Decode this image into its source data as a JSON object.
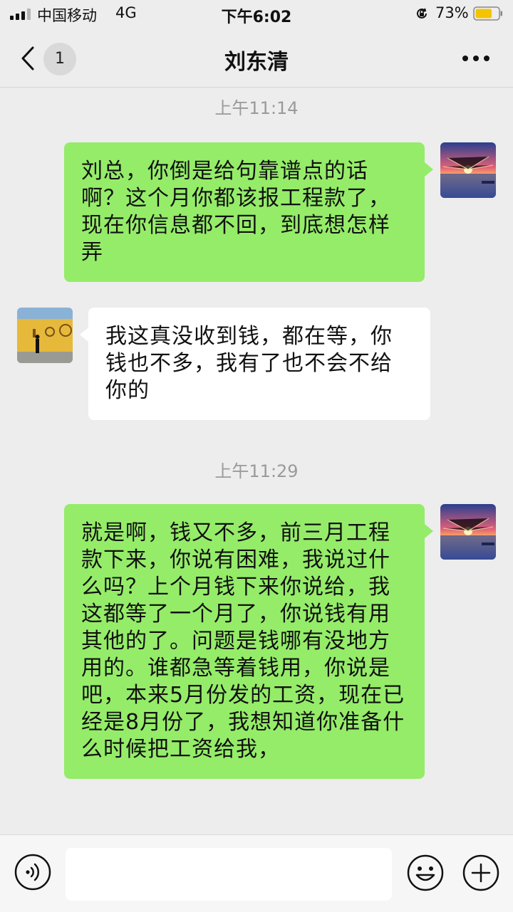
{
  "status_bar": {
    "carrier": "中国移动",
    "network": "4G",
    "time": "下午6:02",
    "battery_percent": "73%",
    "battery_level": 0.73,
    "battery_color": "#f5c400",
    "icons": [
      "signal-icon",
      "orientation-lock-icon",
      "battery-icon"
    ]
  },
  "nav": {
    "unread_count": "1",
    "title": "刘东清",
    "icons": [
      "back-chevron-icon",
      "more-icon"
    ]
  },
  "chat": {
    "messages": [
      {
        "type": "time",
        "text": "上午11:14"
      },
      {
        "type": "sent",
        "text": "刘总，你倒是给句靠谱点的话啊？这个月你都该报工程款了，现在你信息都不回，到底想怎样弄"
      },
      {
        "type": "received",
        "text": "我这真没收到钱，都在等，你钱也不多，我有了也不会不给你的"
      },
      {
        "type": "time",
        "text": "上午11:29"
      },
      {
        "type": "sent",
        "text": "就是啊，钱又不多，前三月工程款下来，你说有困难，我说过什么吗？上个月钱下来你说给，我这都等了一个月了，你说钱有用其他的了。问题是钱哪有没地方用的。谁都急等着钱用，你说是吧，本来5月份发的工资，现在已经是8月份了，我想知道你准备什么时候把工资给我，"
      }
    ]
  },
  "input_bar": {
    "text_value": "",
    "icons": [
      "voice-icon",
      "emoji-icon",
      "plus-icon"
    ]
  },
  "colors": {
    "background": "#ededed",
    "sent_bubble": "#95ec69",
    "received_bubble": "#ffffff",
    "timestamp_text": "#9a9a9a"
  }
}
